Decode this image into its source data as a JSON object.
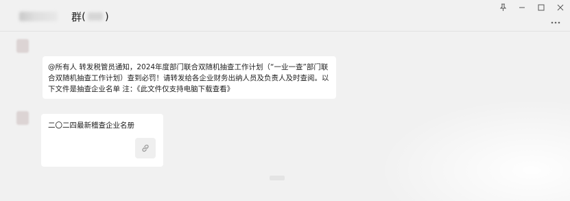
{
  "window": {
    "pin_icon": "pin-icon",
    "minimize_icon": "minimize-icon",
    "maximize_icon": "maximize-icon",
    "close_icon": "close-icon",
    "more_icon": "more-icon"
  },
  "chat": {
    "group_label": "群",
    "paren_open": "(",
    "paren_close": ")"
  },
  "messages": [
    {
      "type": "text",
      "text": "@所有人 转发税管员通知，2024年度部门联合双随机抽查工作计划（“一业一查”部门联合双随机抽查工作计划）查到必罚！请转发给各企业财务出纳人员及负责人及时查阅。以下文件是抽查企业名单 注：《此文件仅支持电脑下载查看》"
    },
    {
      "type": "file",
      "title": "二〇二四最新稽查企业名册",
      "icon": "link-icon"
    }
  ]
}
